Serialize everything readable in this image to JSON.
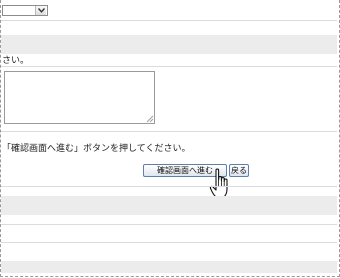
{
  "form": {
    "select_value": "",
    "comment_prompt": "さい。",
    "comment_value": "",
    "submit_instruction": "「確認画面へ進む」ボタンを押してください。",
    "confirm_button_label": "確認画面へ進む",
    "back_button_label": "戻る"
  },
  "icons": {
    "select_arrow": "chevron-down-icon",
    "cursor": "hand-pointer-icon"
  },
  "colors": {
    "band": "#ececec",
    "separator": "#dcdcdc",
    "button_border": "#5f7fa8"
  }
}
